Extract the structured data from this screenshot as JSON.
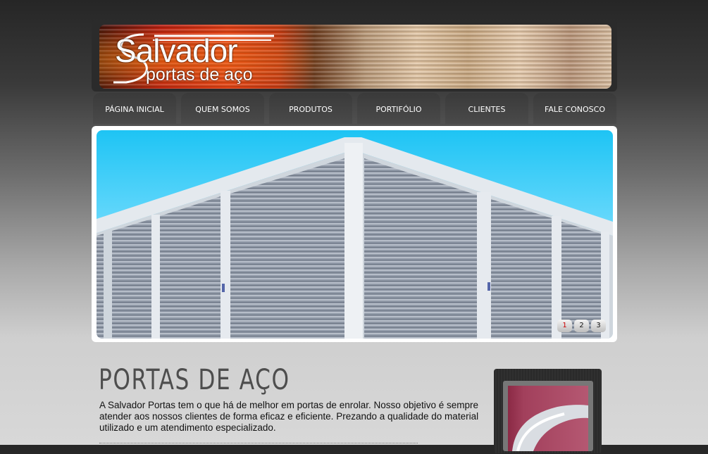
{
  "brand": {
    "name": "Salvador",
    "tagline": "portas de aço"
  },
  "nav": {
    "items": [
      {
        "label": "PÁGINA INICIAL"
      },
      {
        "label": "QUEM SOMOS"
      },
      {
        "label": "PRODUTOS"
      },
      {
        "label": "PORTIFÓLIO"
      },
      {
        "label": "CLIENTES"
      },
      {
        "label": "FALE CONOSCO"
      }
    ]
  },
  "slider": {
    "pages": [
      "1",
      "2",
      "3"
    ],
    "active_page": "1"
  },
  "content": {
    "title": "PORTAS DE AÇO",
    "text": "A Salvador Portas tem o que há de melhor em portas de enrolar. Nosso objetivo é sempre atender aos nossos clientes de forma eficaz e eficiente. Prezando a qualidade do material utilizado e um atendimento especializado."
  },
  "colors": {
    "brand_red": "#e23a10",
    "nav_bg": "#3a3a3a",
    "sky": "#1ec4f4",
    "pager_active": "#cc0000"
  },
  "icons": {
    "logo": "salvador-swoosh-logo"
  }
}
